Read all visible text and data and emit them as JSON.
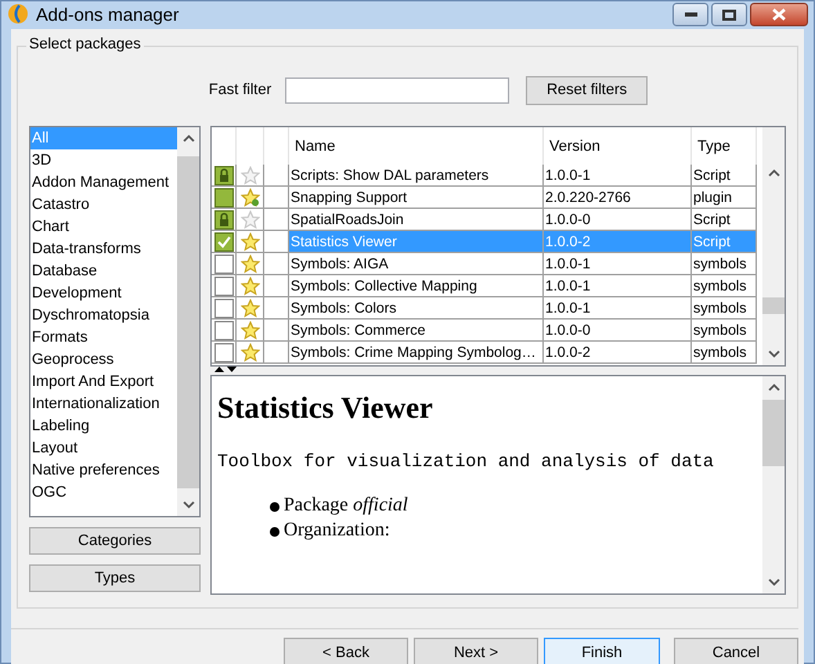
{
  "window": {
    "title": "Add-ons manager"
  },
  "group": {
    "title": "Select packages"
  },
  "filter": {
    "label": "Fast filter",
    "reset_button": "Reset filters"
  },
  "categories": [
    {
      "label": "All",
      "selected": true
    },
    {
      "label": "3D",
      "selected": false
    },
    {
      "label": "Addon Management",
      "selected": false
    },
    {
      "label": "Catastro",
      "selected": false
    },
    {
      "label": "Chart",
      "selected": false
    },
    {
      "label": "Data-transforms",
      "selected": false
    },
    {
      "label": "Database",
      "selected": false
    },
    {
      "label": "Development",
      "selected": false
    },
    {
      "label": "Dyschromatopsia",
      "selected": false
    },
    {
      "label": "Formats",
      "selected": false
    },
    {
      "label": "Geoprocess",
      "selected": false
    },
    {
      "label": "Import And Export",
      "selected": false
    },
    {
      "label": "Internationalization",
      "selected": false
    },
    {
      "label": "Labeling",
      "selected": false
    },
    {
      "label": "Layout",
      "selected": false
    },
    {
      "label": "Native preferences",
      "selected": false
    },
    {
      "label": "OGC",
      "selected": false
    }
  ],
  "side_buttons": [
    "Categories",
    "Types"
  ],
  "table": {
    "columns": [
      "Name",
      "Version",
      "Type"
    ],
    "rows": [
      {
        "installed": true,
        "locked": true,
        "checked": false,
        "starred": false,
        "badge": false,
        "name": "Scripts: Show DAL parameters",
        "version": "1.0.0-1",
        "type": "Script",
        "selected": false
      },
      {
        "installed": true,
        "locked": false,
        "checked": false,
        "starred": true,
        "badge": true,
        "name": "Snapping Support",
        "version": "2.0.220-2766",
        "type": "plugin",
        "selected": false
      },
      {
        "installed": true,
        "locked": true,
        "checked": false,
        "starred": false,
        "badge": false,
        "name": "SpatialRoadsJoin",
        "version": "1.0.0-0",
        "type": "Script",
        "selected": false
      },
      {
        "installed": true,
        "locked": false,
        "checked": true,
        "starred": true,
        "badge": false,
        "name": "Statistics Viewer",
        "version": "1.0.0-2",
        "type": "Script",
        "selected": true
      },
      {
        "installed": false,
        "locked": false,
        "checked": false,
        "starred": true,
        "badge": false,
        "name": "Symbols: AIGA",
        "version": "1.0.0-1",
        "type": "symbols",
        "selected": false
      },
      {
        "installed": false,
        "locked": false,
        "checked": false,
        "starred": true,
        "badge": false,
        "name": "Symbols: Collective Mapping",
        "version": "1.0.0-1",
        "type": "symbols",
        "selected": false
      },
      {
        "installed": false,
        "locked": false,
        "checked": false,
        "starred": true,
        "badge": false,
        "name": "Symbols: Colors",
        "version": "1.0.0-1",
        "type": "symbols",
        "selected": false
      },
      {
        "installed": false,
        "locked": false,
        "checked": false,
        "starred": true,
        "badge": false,
        "name": "Symbols: Commerce",
        "version": "1.0.0-0",
        "type": "symbols",
        "selected": false
      },
      {
        "installed": false,
        "locked": false,
        "checked": false,
        "starred": true,
        "badge": false,
        "name": "Symbols: Crime Mapping Symbolog…",
        "version": "1.0.0-2",
        "type": "symbols",
        "selected": false
      }
    ]
  },
  "description": {
    "heading": "Statistics Viewer",
    "summary": "Toolbox for visualization and analysis of data",
    "items": [
      "Package *official*",
      "Organization:"
    ]
  },
  "buttons": [
    {
      "label": "< Back",
      "focused": false
    },
    {
      "label": "Next >",
      "focused": false
    },
    {
      "label": "Finish",
      "focused": true
    },
    {
      "label": "Cancel",
      "focused": false
    }
  ]
}
